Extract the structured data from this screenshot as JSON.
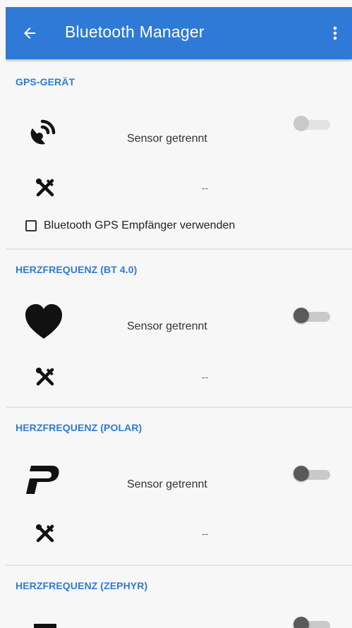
{
  "appbar": {
    "title": "Bluetooth Manager",
    "back_icon": "arrow-left-icon",
    "menu_icon": "more-vert-icon",
    "color": "#2f7ad6"
  },
  "sections": [
    {
      "header": "GPS-GERÄT",
      "icon": "satellite-dish-icon",
      "status": "Sensor getrennt",
      "toggle_enabled": false,
      "toggle_on": false,
      "settings_icon": "tools-icon",
      "settings_value": "--",
      "checkbox_label": "Bluetooth GPS Empfänger verwenden",
      "checkbox_checked": false
    },
    {
      "header": "HERZFREQUENZ (BT 4.0)",
      "icon": "heart-icon",
      "status": "Sensor getrennt",
      "toggle_enabled": true,
      "toggle_on": false,
      "settings_icon": "tools-icon",
      "settings_value": "--"
    },
    {
      "header": "HERZFREQUENZ (POLAR)",
      "icon": "polar-logo-icon",
      "status": "Sensor getrennt",
      "toggle_enabled": true,
      "toggle_on": false,
      "settings_icon": "tools-icon",
      "settings_value": "--"
    },
    {
      "header": "HERZFREQUENZ (ZEPHYR)",
      "icon": "zephyr-logo-icon",
      "toggle_enabled": true,
      "toggle_on": false
    }
  ],
  "colors": {
    "accent": "#2f7ad6",
    "background": "#f7f7f7",
    "divider": "#e4e4e4"
  }
}
